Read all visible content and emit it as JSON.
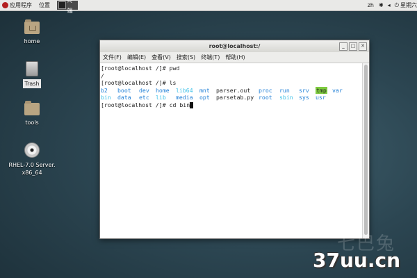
{
  "top_bar": {
    "applications": "应用程序",
    "places": "位置",
    "task_label": "终端",
    "lang": "zh",
    "date": "星期六"
  },
  "desktop": {
    "icons": [
      {
        "label": "home"
      },
      {
        "label": "Trash"
      },
      {
        "label": "tools"
      },
      {
        "label": "RHEL-7.0 Server. x86_64"
      }
    ]
  },
  "terminal": {
    "title": "root@localhost:/",
    "menu": [
      "文件(F)",
      "编辑(E)",
      "查看(V)",
      "搜索(S)",
      "终端(T)",
      "帮助(H)"
    ],
    "lines": [
      "[root@localhost /]# pwd",
      "/",
      "[root@localhost /]# ls"
    ],
    "ls_rows": [
      [
        {
          "name": "b2",
          "color": "#1f7fd6"
        },
        {
          "name": "boot",
          "color": "#1f7fd6"
        },
        {
          "name": "dev",
          "color": "#1f7fd6"
        },
        {
          "name": "home",
          "color": "#1f7fd6"
        },
        {
          "name": "lib64",
          "color": "#3dc1e8"
        },
        {
          "name": "mnt",
          "color": "#1f7fd6"
        },
        {
          "name": "parser.out",
          "color": "#222222"
        },
        {
          "name": "proc",
          "color": "#1f7fd6"
        },
        {
          "name": "run",
          "color": "#1f7fd6"
        },
        {
          "name": "srv",
          "color": "#1f7fd6"
        },
        {
          "name": "tmp",
          "color": "#222222",
          "bg": "#7ecb3f"
        },
        {
          "name": "var",
          "color": "#1f7fd6"
        }
      ],
      [
        {
          "name": "bin",
          "color": "#3dc1e8"
        },
        {
          "name": "data",
          "color": "#1f7fd6"
        },
        {
          "name": "etc",
          "color": "#1f7fd6"
        },
        {
          "name": "lib",
          "color": "#3dc1e8"
        },
        {
          "name": "media",
          "color": "#1f7fd6"
        },
        {
          "name": "opt",
          "color": "#1f7fd6"
        },
        {
          "name": "parsetab.py",
          "color": "#222222"
        },
        {
          "name": "root",
          "color": "#1f7fd6"
        },
        {
          "name": "sbin",
          "color": "#3dc1e8"
        },
        {
          "name": "sys",
          "color": "#1f7fd6"
        },
        {
          "name": "usr",
          "color": "#1f7fd6"
        }
      ]
    ],
    "prompt": "[root@localhost /]# cd bin"
  },
  "watermark": {
    "chinese": "七巴兔",
    "site": "37uu.cn"
  }
}
